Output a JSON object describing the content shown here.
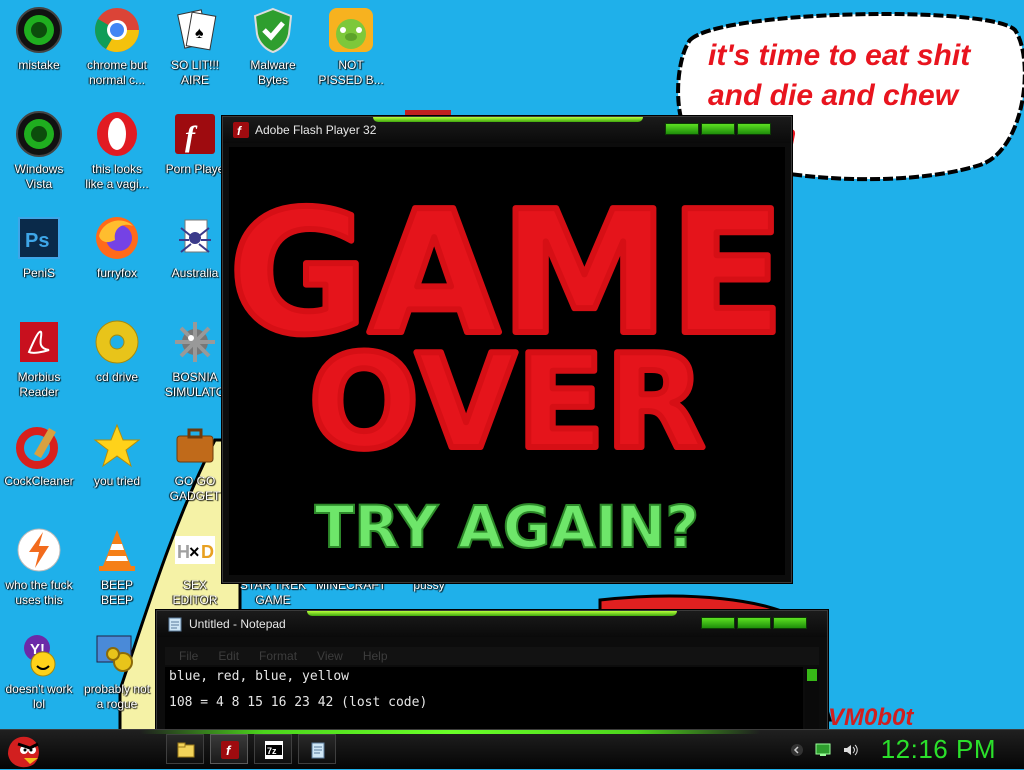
{
  "desktop": {
    "bubble_text": "it's time to eat shit\nand die and chew\ne gum",
    "watermark": "VM0b0t",
    "icons": [
      {
        "label": "mistake",
        "icon": "green-orb-icon"
      },
      {
        "label": "chrome but\nnormal c...",
        "icon": "chrome-icon"
      },
      {
        "label": "SO LIT!!!\nAIRE",
        "icon": "solitaire-icon"
      },
      {
        "label": "Malware\nBytes",
        "icon": "shield-check-icon"
      },
      {
        "label": "NOT\nPISSED B...",
        "icon": "angry-birds-pig-icon"
      },
      {
        "label": "Windows\nVista",
        "icon": "green-orb-icon"
      },
      {
        "label": "this looks\nlike a vagi...",
        "icon": "opera-icon"
      },
      {
        "label": "Porn Playe",
        "icon": "flash-icon"
      },
      {
        "label": "PeniS",
        "icon": "photoshop-icon"
      },
      {
        "label": "furryfox",
        "icon": "firefox-icon"
      },
      {
        "label": "Australia",
        "icon": "spider-solitaire-icon"
      },
      {
        "label": "Morbius\nReader",
        "icon": "pdf-reader-icon"
      },
      {
        "label": "cd drive",
        "icon": "cd-icon"
      },
      {
        "label": "BOSNIA\nSIMULATO",
        "icon": "minesweeper-icon"
      },
      {
        "label": "CockCleaner",
        "icon": "ccleaner-icon"
      },
      {
        "label": "you tried",
        "icon": "star-icon"
      },
      {
        "label": "GO GO\nGADGET",
        "icon": "briefcase-icon"
      },
      {
        "label": "who the fuck\nuses this",
        "icon": "lightning-icon"
      },
      {
        "label": "BEEP\nBEEP",
        "icon": "vlc-cone-icon"
      },
      {
        "label": "SEX\nEDITOR",
        "icon": "hxd-icon"
      },
      {
        "label": "STAR TREK\nGAME",
        "icon": "star-trek-icon"
      },
      {
        "label": "MINECRAFT",
        "icon": "minecraft-icon"
      },
      {
        "label": "pussy",
        "icon": "cat-icon"
      },
      {
        "label": "doesn't work\nlol",
        "icon": "yahoo-messenger-icon"
      },
      {
        "label": "probably not\na rogue",
        "icon": "gears-monitor-icon"
      }
    ]
  },
  "flash_window": {
    "title": "Adobe Flash Player 32",
    "screen": {
      "line1": "GAME",
      "line2": "OVER",
      "line3": "TRY AGAIN?"
    }
  },
  "notepad_window": {
    "title": "Untitled - Notepad",
    "menu": [
      "File",
      "Edit",
      "Format",
      "View",
      "Help"
    ],
    "lines": [
      "blue, red, blue, yellow",
      "108 = 4 8 15 16 23 42 (lost code)"
    ]
  },
  "taskbar": {
    "clock": "12:16 PM",
    "buttons": [
      "explorer-icon",
      "flash-icon",
      "7zip-icon",
      "notepad-icon"
    ]
  },
  "colors": {
    "desktop_bg": "#1fb0ea",
    "accent_green": "#4cd41c",
    "game_over_red": "#e5141b",
    "try_again_green": "#6ee66a"
  }
}
